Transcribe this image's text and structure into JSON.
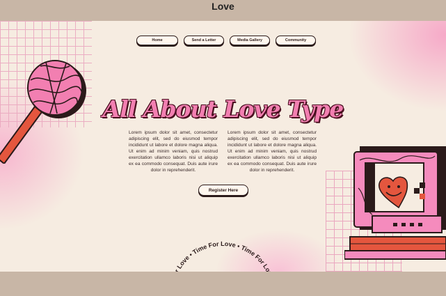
{
  "window": {
    "title": "Love"
  },
  "nav": {
    "items": [
      "Home",
      "Send a Letter",
      "Media Gallery",
      "Community"
    ]
  },
  "hero": {
    "title": "All About Love Type",
    "col_left": "Lorem ipsum dolor sit amet, consectetur adipiscing elit, sed do eiusmod tempor incididunt ut labore et dolore magna aliqua. Ut enim ad minim veniam, quis nostrud exercitation ullamco laboris nisi ut aliquip ex ea commodo consequat. Duis aute irure dolor in reprehenderit.",
    "col_right": "Lorem ipsum dolor sit amet, consectetur adipiscing elit, sed do eiusmod tempor incididunt ut labore et dolore magna aliqua. Ut enim ad minim veniam, quis nostrud exercitation ullamco laboris nisi ut aliquip ex ea commodo consequat. Duis aute irure dolor in reprehenderit.",
    "register_label": "Register Here"
  },
  "circle_text": "Time For Love • Time For Love • Time For Love",
  "colors": {
    "pink": "#f27fb1",
    "dark": "#2b1a1a",
    "cream": "#f6ece1",
    "red": "#e4563e",
    "grid": "#eaa7bf"
  },
  "icons": [
    "lollipop-icon",
    "retro-computer-icon",
    "heart-smiley-icon"
  ]
}
